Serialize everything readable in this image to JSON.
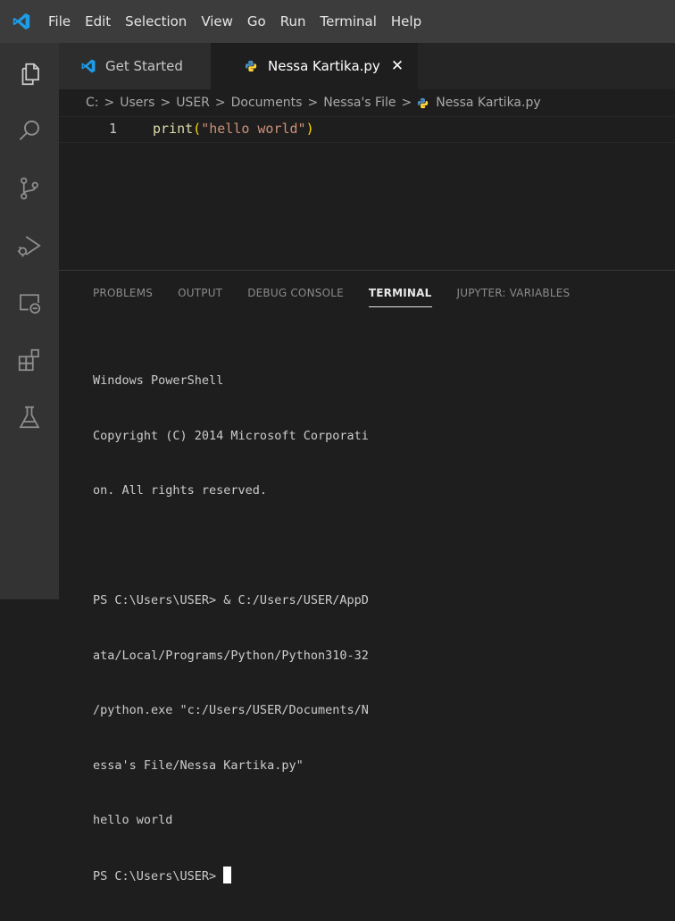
{
  "menu": {
    "items": [
      "File",
      "Edit",
      "Selection",
      "View",
      "Go",
      "Run",
      "Terminal",
      "Help"
    ]
  },
  "colors": {
    "accent_blue": "#1e9ce6",
    "python_blue": "#4b8bbe",
    "python_yellow": "#ffd43b"
  },
  "activity_bar": {
    "icons": [
      "explorer-icon",
      "search-icon",
      "source-control-icon",
      "run-debug-icon",
      "remote-explorer-icon",
      "extensions-icon",
      "testing-icon"
    ]
  },
  "tabs": [
    {
      "label": "Get Started",
      "icon": "vscode-logo-icon"
    },
    {
      "label": "Nessa Kartika.py",
      "icon": "python-icon",
      "close": "✕"
    }
  ],
  "breadcrumb": {
    "parts": [
      "C:",
      "Users",
      "USER",
      "Documents",
      "Nessa's File",
      "Nessa Kartika.py"
    ],
    "separator": ">"
  },
  "editor": {
    "line_number": "1",
    "code": {
      "fn": "print",
      "open": "(",
      "str": "\"hello world\"",
      "close": ")"
    }
  },
  "panel": {
    "tabs": [
      "PROBLEMS",
      "OUTPUT",
      "DEBUG CONSOLE",
      "TERMINAL",
      "JUPYTER: VARIABLES"
    ],
    "active_tab": "TERMINAL"
  },
  "terminal": {
    "lines": [
      "Windows PowerShell",
      "Copyright (C) 2014 Microsoft Corporati",
      "on. All rights reserved.",
      "",
      "PS C:\\Users\\USER> & C:/Users/USER/AppD",
      "ata/Local/Programs/Python/Python310-32",
      "/python.exe \"c:/Users/USER/Documents/N",
      "essa's File/Nessa Kartika.py\"",
      "hello world"
    ],
    "prompt": "PS C:\\Users\\USER> "
  }
}
